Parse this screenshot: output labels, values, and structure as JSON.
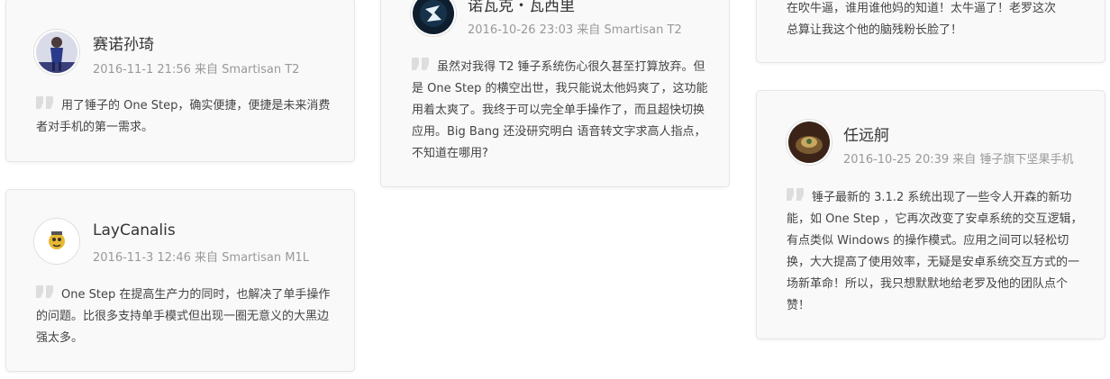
{
  "comments": [
    {
      "name": "赛诺孙琦",
      "date": "2016-11-1 21:56",
      "via": "来自",
      "device": "Smartisan T2",
      "text": "用了锤子的 One Step，确实便捷，便捷是未来消费者对手机的第一需求。"
    },
    {
      "name": "LayCanalis",
      "date": "2016-11-3 12:46",
      "via": "来自",
      "device": "Smartisan M1L",
      "text": "One Step 在提高生产力的同时，也解决了单手操作的问题。比很多支持单手模式但出现一圈无意义的大黑边强太多。"
    },
    {
      "name": "诺瓦克・瓦西里",
      "date": "2016-10-26 23:03",
      "via": "来自",
      "device": "Smartisan T2",
      "text": "虽然对我得 T2 锤子系统伤心很久甚至打算放弃。但是 One Step 的横空出世，我只能说太他妈爽了，这功能用着太爽了。我终于可以完全单手操作了，而且超快切换应用。Big Bang 还没研究明白 语音转文字求高人指点，不知道在哪用?"
    },
    {
      "text": "在吹牛逼，谁用谁他妈的知道！太牛逼了！老罗这次总算让我这个他的脑残粉长脸了！"
    },
    {
      "name": "任远舸",
      "date": "2016-10-25 20:39",
      "via": "来自",
      "device": "锤子旗下坚果手机",
      "text": "锤子最新的 3.1.2 系统出现了一些令人开森的新功能，如 One Step ，它再次改变了安卓系统的交互逻辑，有点类似 Windows 的操作模式。应用之间可以轻松切换，大大提高了使用效率，无疑是安卓系统交互方式的一场新革命！所以，我只想默默地给老罗及他的团队点个赞！"
    }
  ],
  "icons": {
    "quote": "quote-icon",
    "avatar": "avatar"
  },
  "colors": {
    "card_bg": "#f9f9f9",
    "border": "#e6e6e6",
    "meta": "#999999",
    "text": "#444444",
    "quote": "#dddddd"
  }
}
